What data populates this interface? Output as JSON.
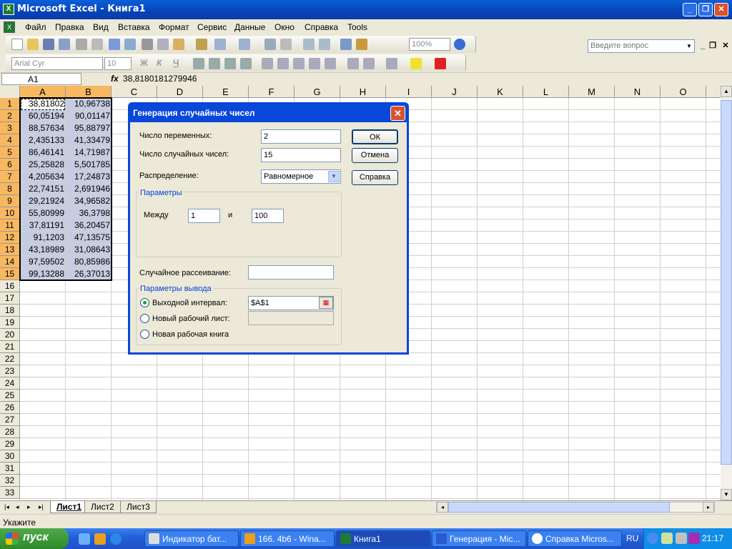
{
  "window": {
    "title": "Microsoft Excel - Книга1",
    "minimize": "_",
    "restore": "❐",
    "close": "✕"
  },
  "menu": {
    "items": [
      "Файл",
      "Правка",
      "Вид",
      "Вставка",
      "Формат",
      "Сервис",
      "Данные",
      "Окно",
      "Справка",
      "Tools"
    ],
    "help_placeholder": "Введите вопрос",
    "mdi_min": "_",
    "mdi_restore": "❐",
    "mdi_close": "✕"
  },
  "toolbar": {
    "zoom": "100%",
    "font": "Arial Cyr",
    "size": "10",
    "bold": "Ж",
    "italic": "К",
    "underline": "Ч"
  },
  "formula_bar": {
    "name_box": "A1",
    "fx": "fx",
    "formula": "38,8180181279946"
  },
  "sheet": {
    "columns": [
      "A",
      "B",
      "C",
      "D",
      "E",
      "F",
      "G",
      "H",
      "I",
      "J",
      "K",
      "L",
      "M",
      "N",
      "O"
    ],
    "rows": [
      "1",
      "2",
      "3",
      "4",
      "5",
      "6",
      "7",
      "8",
      "9",
      "10",
      "11",
      "12",
      "13",
      "14",
      "15",
      "16",
      "17",
      "18",
      "19",
      "20",
      "21",
      "22",
      "23",
      "24",
      "25",
      "26",
      "27",
      "28",
      "29",
      "30",
      "31",
      "32",
      "33"
    ],
    "col_a": [
      "38,81802",
      "60,05194",
      "88,57634",
      "2,435133",
      "86,46141",
      "25,25828",
      "4,205634",
      "22,74151",
      "29,21924",
      "55,80999",
      "37,81191",
      "91,1203",
      "43,18989",
      "97,59502",
      "99,13288"
    ],
    "col_b": [
      "10,96738",
      "90,01147",
      "95,88797",
      "41,33479",
      "14,71987",
      "5,501785",
      "17,24873",
      "2,691946",
      "34,96582",
      "36,3798",
      "36,20457",
      "47,13575",
      "31,08643",
      "80,85986",
      "26,37013"
    ]
  },
  "tabs": {
    "nav": [
      "|◂",
      "◂",
      "▸",
      "▸|"
    ],
    "sheets": [
      "Лист1",
      "Лист2",
      "Лист3"
    ]
  },
  "status": {
    "text": "Укажите"
  },
  "taskbar": {
    "start": "пуск",
    "tasks": [
      "Индикатор бат...",
      "166. 4b6 - Wina...",
      "Книга1",
      "Генерация - Mic...",
      "Справка Micros..."
    ],
    "lang": "RU",
    "clock": "21:17"
  },
  "dialog": {
    "title": "Генерация случайных чисел",
    "close": "✕",
    "num_vars_label": "Число переменных:",
    "num_vars_value": "2",
    "num_random_label": "Число случайных чисел:",
    "num_random_value": "15",
    "distribution_label": "Распределение:",
    "distribution_value": "Равномерное",
    "params_title": "Параметры",
    "between_label": "Между",
    "between_from": "1",
    "and_label": "и",
    "between_to": "100",
    "seed_label": "Случайное рассеивание:",
    "seed_value": "",
    "output_title": "Параметры вывода",
    "output_range_label": "Выходной интервал:",
    "output_range_value": "$A$1",
    "new_sheet_label": "Новый рабочий лист:",
    "new_book_label": "Новая рабочая книга",
    "ok": "ОК",
    "cancel": "Отмена",
    "help": "Справка"
  }
}
